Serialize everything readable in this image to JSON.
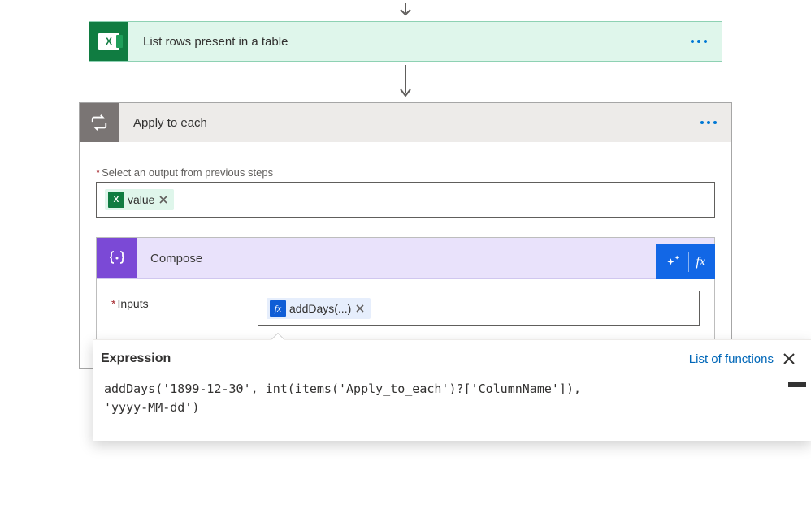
{
  "excel_action": {
    "title": "List rows present in a table"
  },
  "foreach": {
    "title": "Apply to each",
    "output_label": "Select an output from previous steps",
    "token_value": "value"
  },
  "compose": {
    "title": "Compose",
    "inputs_label": "Inputs",
    "fx_token": "addDays(...)"
  },
  "expression": {
    "tab_title": "Expression",
    "link_label": "List of functions",
    "code": "addDays('1899-12-30', int(items('Apply_to_each')?['ColumnName']),\n'yyyy-MM-dd')"
  },
  "icons": {
    "fx": "fx"
  }
}
